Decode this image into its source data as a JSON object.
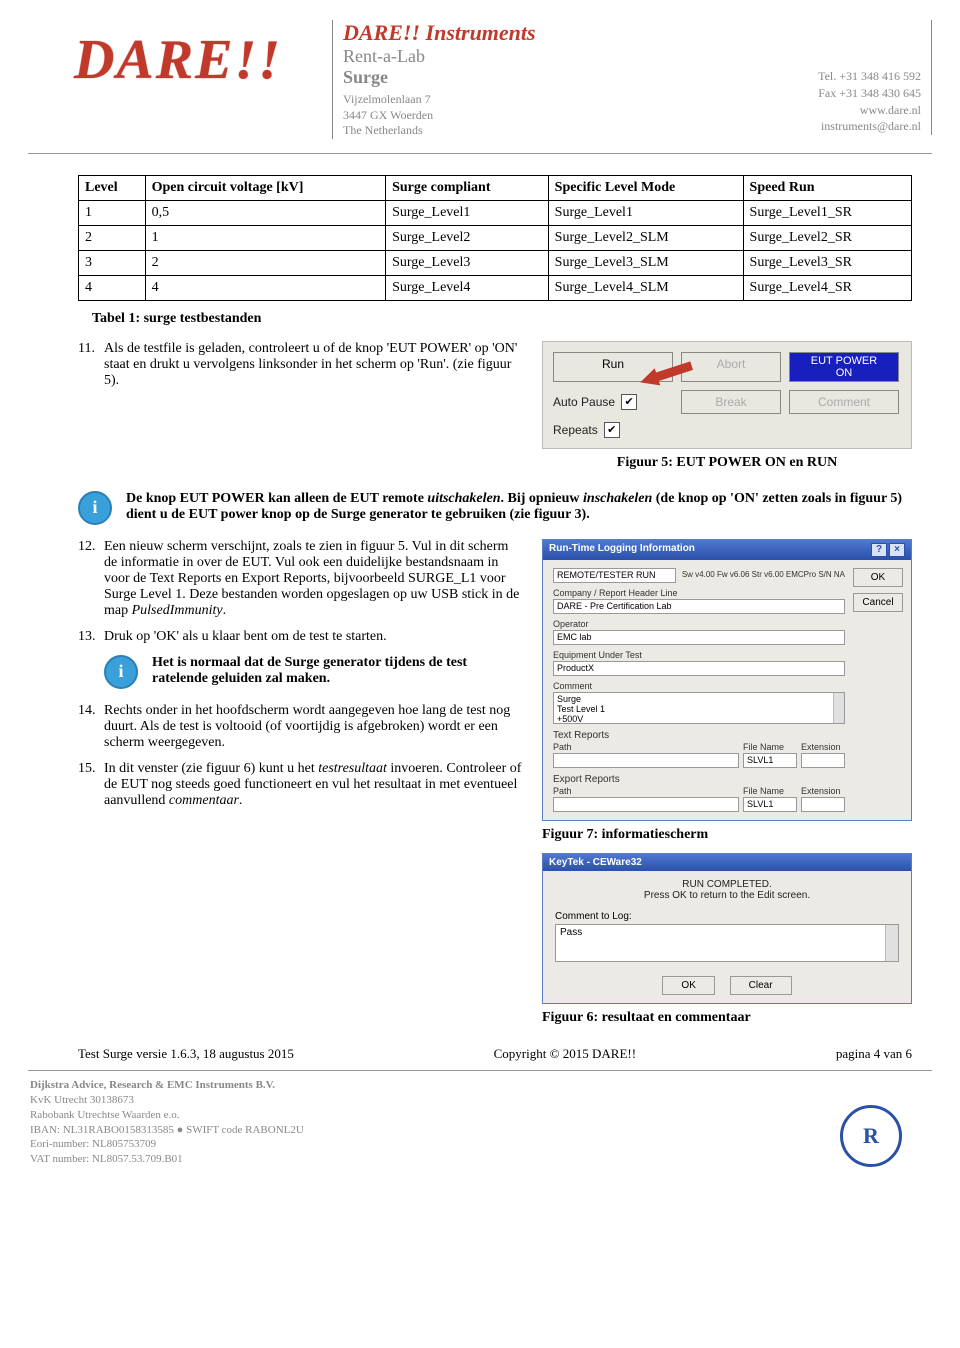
{
  "header": {
    "logo": "DARE!!",
    "company": "DARE!! Instruments",
    "sub1": "Rent-a-Lab",
    "sub2": "Surge",
    "addr1": "Vijzelmolenlaan 7",
    "addr2": "3447 GX  Woerden",
    "addr3": "The Netherlands",
    "tel": "Tel. +31 348 416 592",
    "fax": "Fax +31 348 430 645",
    "web": "www.dare.nl",
    "email": "instruments@dare.nl"
  },
  "table": {
    "headers": [
      "Level",
      "Open circuit voltage [kV]",
      "Surge compliant",
      "Specific Level Mode",
      "Speed Run"
    ],
    "rows": [
      [
        "1",
        "0,5",
        "Surge_Level1",
        "Surge_Level1",
        "Surge_Level1_SR"
      ],
      [
        "2",
        "1",
        "Surge_Level2",
        "Surge_Level2_SLM",
        "Surge_Level2_SR"
      ],
      [
        "3",
        "2",
        "Surge_Level3",
        "Surge_Level3_SLM",
        "Surge_Level3_SR"
      ],
      [
        "4",
        "4",
        "Surge_Level4",
        "Surge_Level4_SLM",
        "Surge_Level4_SR"
      ]
    ],
    "caption": "Tabel 1: surge testbestanden"
  },
  "step11": {
    "n": "11.",
    "text": "Als de testfile is geladen, controleert u of de knop 'EUT POWER' op 'ON' staat en drukt u vervolgens linksonder in het scherm op 'Run'. (zie figuur 5)."
  },
  "fig5": {
    "run": "Run",
    "abort": "Abort",
    "eut1": "EUT POWER",
    "eut2": "ON",
    "autopause": "Auto Pause",
    "break": "Break",
    "comment": "Comment",
    "repeats": "Repeats",
    "check": "✔",
    "caption": "Figuur 5: EUT POWER ON en RUN"
  },
  "info1": {
    "text_a": "De knop EUT POWER kan alleen de EUT remote ",
    "text_b": "uitschakelen",
    "text_c": ". Bij opnieuw ",
    "text_d": "inschakelen",
    "text_e": " (de knop op 'ON' zetten zoals in figuur 5) dient u de EUT power knop op de Surge generator te gebruiken (zie figuur 3)."
  },
  "step12": {
    "n": "12.",
    "text": "Een nieuw scherm verschijnt, zoals te zien in figuur 5. Vul in dit scherm de informatie in over de EUT. Vul ook een duidelijke bestandsnaam in voor de Text Reports en Export Reports, bijvoorbeeld SURGE_L1 voor Surge Level 1. Deze bestanden worden opgeslagen op uw USB stick in de map ",
    "em": "PulsedImmunity",
    "dot": "."
  },
  "step13": {
    "n": "13.",
    "text": "Druk op 'OK' als u klaar bent om de test te starten."
  },
  "info2": {
    "text": "Het is normaal dat de Surge generator tijdens de test ratelende geluiden zal maken."
  },
  "step14": {
    "n": "14.",
    "text": "Rechts onder in het hoofdscherm wordt aangegeven hoe lang de test nog duurt. Als de test is voltooid (of voortijdig is afgebroken) wordt er een scherm weergegeven."
  },
  "step15": {
    "n": "15.",
    "a": "In dit venster (zie figuur 6) kunt u het ",
    "b": "testresultaat",
    "c": " invoeren. Controleer of de EUT nog steeds goed functioneert en vul het resultaat in met eventueel aanvullend ",
    "d": "commentaar",
    "e": "."
  },
  "dlg7": {
    "title": "Run-Time Logging Information",
    "top_field": "REMOTE/TESTER RUN",
    "top_meta": "Sw v4.00  Fw v6.06  Str v6.00  EMCPro  S/N NA",
    "ok": "OK",
    "cancel": "Cancel",
    "lab_company": "Company / Report Header Line",
    "val_company": "DARE - Pre Certification Lab",
    "lab_operator": "Operator",
    "val_operator": "EMC lab",
    "lab_eut": "Equipment Under Test",
    "val_eut": "ProductX",
    "lab_comment": "Comment",
    "val_comment_1": "Surge",
    "val_comment_2": "Test Level 1",
    "val_comment_3": "+500V",
    "sec_text": "Text Reports",
    "sec_export": "Export Reports",
    "lab_path": "Path",
    "lab_fn": "File Name",
    "lab_ext": "Extension",
    "val_fn": "SLVL1",
    "caption": "Figuur 7: informatiescherm"
  },
  "dlg6": {
    "title": "KeyTek - CEWare32",
    "line1": "RUN COMPLETED.",
    "line2": "Press OK to return to the Edit screen.",
    "lab_comment": "Comment to Log:",
    "val_comment": "Pass",
    "ok": "OK",
    "clear": "Clear",
    "caption": "Figuur 6: resultaat en commentaar"
  },
  "footer": {
    "left": "Test Surge versie 1.6.3, 18 augustus 2015",
    "mid": "Copyright © 2015 DARE!!",
    "right": "pagina 4 van 6"
  },
  "company_footer": {
    "name": "Dijkstra Advice, Research & EMC Instruments B.V.",
    "kvk": "KvK Utrecht 30138673",
    "bank": "Rabobank Utrechtse Waarden e.o.",
    "iban_a": "IBAN: NL31RABO0158313585 ",
    "bullet": "●",
    "iban_b": " SWIFT code RABONL2U",
    "eori": "Eori-number: NL805753709",
    "vat": "VAT number: NL8057.53.709.B01",
    "seal": "R"
  }
}
